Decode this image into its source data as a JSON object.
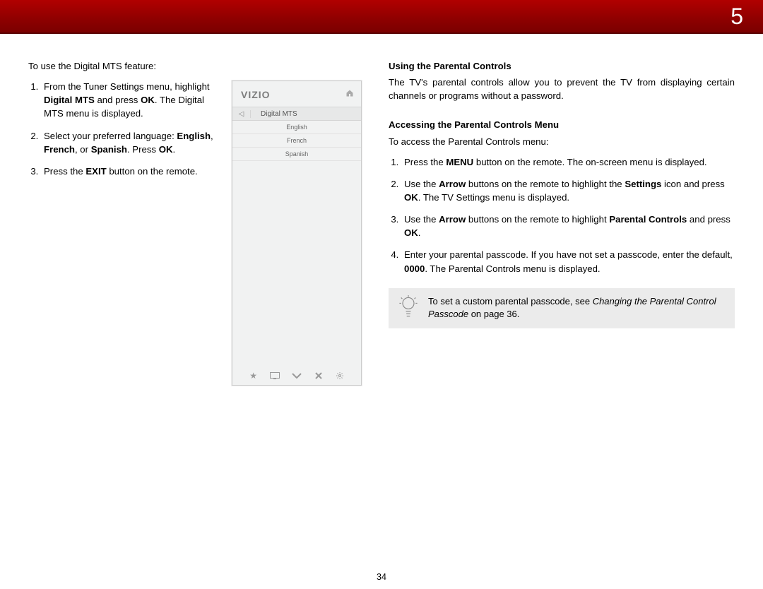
{
  "chapter_number": "5",
  "page_number": "34",
  "left": {
    "intro": "To use the Digital MTS feature:",
    "step1_a": "From the Tuner Settings menu, highlight ",
    "step1_b": "Digital MTS",
    "step1_c": " and press ",
    "step1_d": "OK",
    "step1_e": ". The Digital MTS menu is displayed.",
    "step2_a": "Select your preferred language: ",
    "step2_b": "English",
    "step2_c": ", ",
    "step2_d": "French",
    "step2_e": ", or ",
    "step2_f": "Spanish",
    "step2_g": ". Press ",
    "step2_h": "OK",
    "step2_i": ".",
    "step3_a": "Press the ",
    "step3_b": "EXIT",
    "step3_c": " button on the remote."
  },
  "tv_menu": {
    "logo": "VIZIO",
    "back_arrow": "◁",
    "title": "Digital MTS",
    "items": [
      "English",
      "French",
      "Spanish"
    ]
  },
  "right": {
    "h1": "Using the Parental Controls",
    "p1": "The TV's parental controls allow you to prevent the TV from displaying certain channels or programs without a password.",
    "h2": "Accessing the Parental Controls Menu",
    "p2": "To access the Parental Controls menu:",
    "s1_a": "Press the ",
    "s1_b": "MENU",
    "s1_c": " button on the remote. The on-screen menu is displayed.",
    "s2_a": "Use the ",
    "s2_b": "Arrow",
    "s2_c": " buttons on the remote to highlight the ",
    "s2_d": "Settings",
    "s2_e": " icon and press ",
    "s2_f": "OK",
    "s2_g": ". The TV Settings menu is displayed.",
    "s3_a": "Use the ",
    "s3_b": "Arrow",
    "s3_c": " buttons on the remote to highlight ",
    "s3_d": "Parental Controls",
    "s3_e": " and press ",
    "s3_f": "OK",
    "s3_g": ".",
    "s4_a": "Enter your parental passcode. If you have not set a passcode, enter the default, ",
    "s4_b": "0000",
    "s4_c": ". The Parental Controls menu is displayed.",
    "tip_a": "To set a custom parental passcode, see ",
    "tip_b": "Changing the Parental Control Passcode",
    "tip_c": " on page 36."
  }
}
